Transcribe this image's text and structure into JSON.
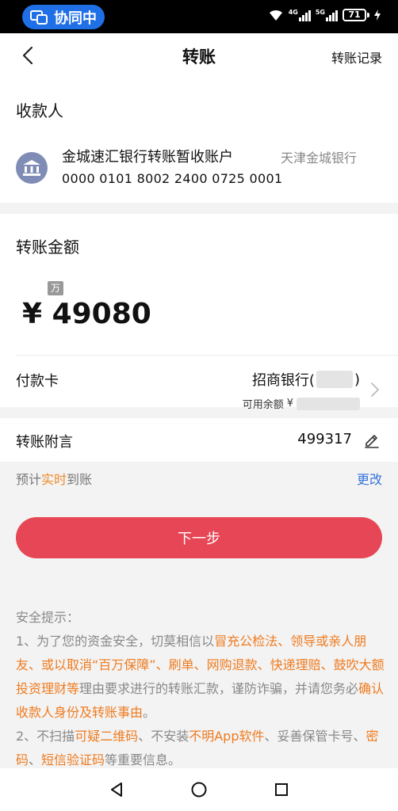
{
  "status_bar": {
    "pill_label": "协同中",
    "network_1": "4G",
    "network_2": "5G",
    "battery": "71"
  },
  "nav": {
    "title": "转账",
    "record_label": "转账记录"
  },
  "payee": {
    "section_title": "收款人",
    "name": "金城速汇银行转账暂收账户",
    "bank": "天津金城银行",
    "account": "0000 0101 8002 2400 0725 0001"
  },
  "amount_section": {
    "title": "转账金额",
    "unit_tag": "万",
    "amount": "¥ 49080"
  },
  "payment_card": {
    "label": "付款卡",
    "bank_prefix": "招商银行(",
    "bank_suffix": ")",
    "balance_label": "可用余额",
    "currency": "¥"
  },
  "memo": {
    "label": "转账附言",
    "value": "499317"
  },
  "arrival": {
    "prefix": "预计",
    "highlight": "实时",
    "suffix": "到账",
    "change_label": "更改"
  },
  "next_button": "下一步",
  "security_tips": {
    "heading": "安全提示：",
    "t1": "1、为了您的资金安全，切莫相信以",
    "t2": "冒充公检法、领导或亲人朋友、或以取消“百万保障”、刷单、网购退款、快递理赔、鼓吹大额投资理财等",
    "t3": "理由要求进行的转账汇款，谨防诈骗，并请您务必",
    "t4": "确认收款人身份及转账事由",
    "t5": "。",
    "t6": "2、不扫描",
    "t7": "可疑二维码",
    "t8": "、不安装",
    "t9": "不明App软件",
    "t10": "、妥善保管卡号、",
    "t11": "密码",
    "t12": "、",
    "t13": "短信验证码",
    "t14": "等重要信息。"
  },
  "colors": {
    "primary_button": "#e64655",
    "highlight_orange": "#ef7b1f",
    "link_blue": "#3574d8",
    "pill_blue": "#1f6fe6"
  }
}
